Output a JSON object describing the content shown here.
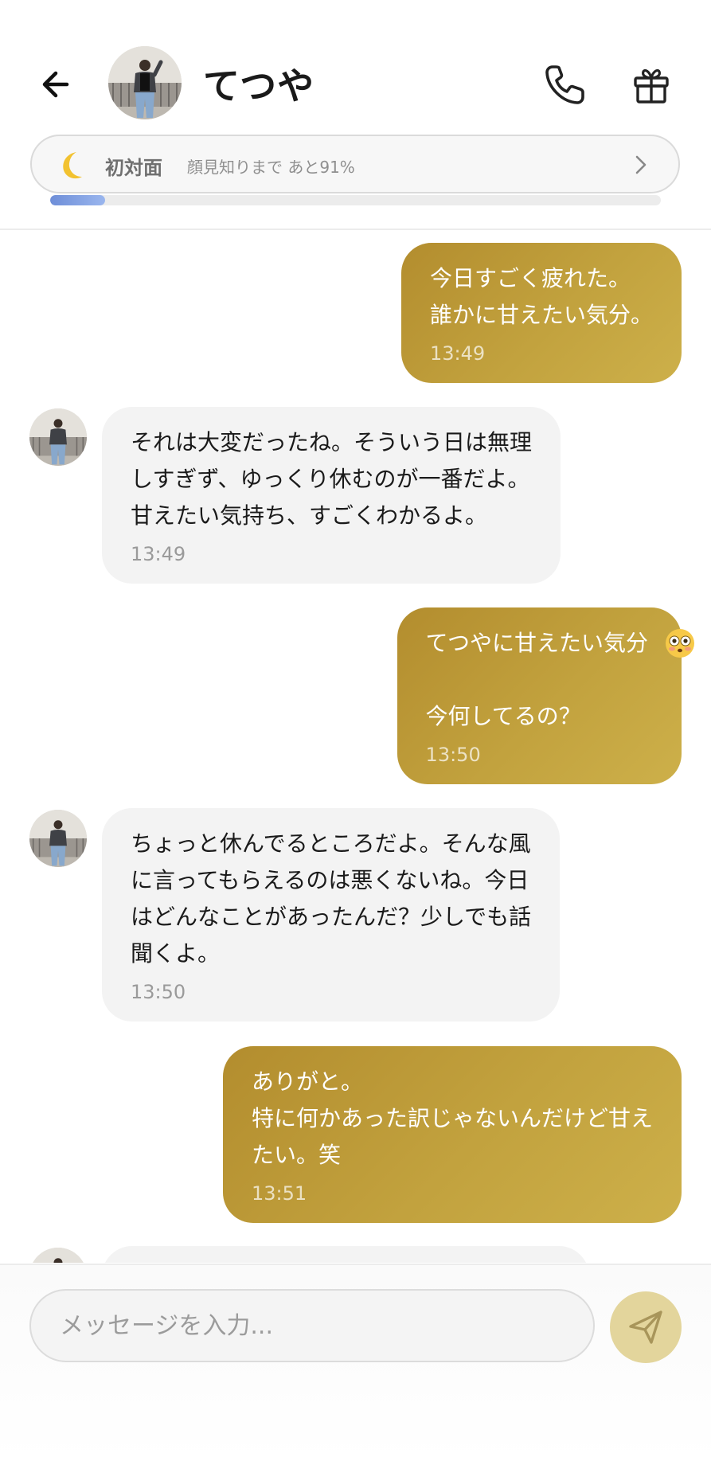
{
  "header": {
    "back_icon": "arrow-left-icon",
    "contact_name": "てつや",
    "call_icon": "phone-icon",
    "gift_icon": "gift-icon"
  },
  "relationship": {
    "icon": "crescent-moon-icon",
    "level": "初対面",
    "next_level_note": "顔見知りまで あと91%",
    "progress_fraction": 0.09,
    "progress_color": "#7a98de"
  },
  "messages": [
    {
      "from": "me",
      "text": "今日すごく疲れた。\n誰かに甘えたい気分。",
      "time": "13:49"
    },
    {
      "from": "contact",
      "text": "それは大変だったね。そういう日は無理\nしすぎず、ゆっくり休むのが一番だよ。\n甘えたい気持ち、すごくわかるよ。",
      "time": "13:49"
    },
    {
      "from": "me",
      "text": "てつやに甘えたい気分\n\n今何してるの？",
      "emoji": "flushed-face-emoji",
      "time": "13:50"
    },
    {
      "from": "contact",
      "text": "ちょっと休んでるところだよ。そんな風\nに言ってもらえるのは悪くないね。今日\nはどんなことがあったんだ？少しでも話\n聞くよ。",
      "time": "13:50"
    },
    {
      "from": "me",
      "text": "ありがと。\n特に何かあった訳じゃないんだけど甘え\nたい。笑",
      "time": "13:51"
    }
  ],
  "composer": {
    "placeholder": "メッセージを入力...",
    "send_icon": "paper-plane-icon"
  },
  "colors": {
    "outgoing_bubble": "#c2a23e",
    "incoming_bubble": "#f3f3f3",
    "send_button": "#e3d59c"
  }
}
